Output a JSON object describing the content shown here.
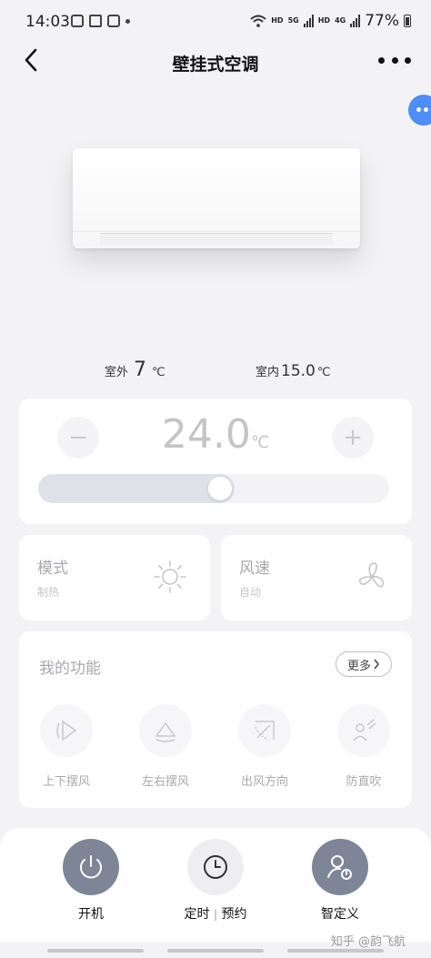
{
  "status_bar": {
    "time": "14:03",
    "hd1": "HD",
    "net1": "5G",
    "hd2": "HD",
    "net2": "4G",
    "battery": "77%"
  },
  "header": {
    "title": "壁挂式空调"
  },
  "temps": {
    "outdoor_label": "室外",
    "outdoor_value": "7",
    "outdoor_unit": "℃",
    "indoor_label": "室内",
    "indoor_value": "15.0",
    "indoor_unit": "℃"
  },
  "setpoint": {
    "minus": "−",
    "plus": "+",
    "value": "24.0",
    "unit": "℃",
    "slider_fraction": 0.56
  },
  "mode_card": {
    "title": "模式",
    "value": "制热",
    "icon": "sun-icon"
  },
  "speed_card": {
    "title": "风速",
    "value": "自动",
    "icon": "fan-icon"
  },
  "functions": {
    "title": "我的功能",
    "more_label": "更多",
    "items": [
      {
        "label": "上下摆风",
        "icon": "vertical-swing-icon"
      },
      {
        "label": "左右摆风",
        "icon": "horizontal-swing-icon"
      },
      {
        "label": "出风方向",
        "icon": "wind-direction-icon"
      },
      {
        "label": "防直吹",
        "icon": "anti-direct-blow-icon"
      }
    ]
  },
  "bottom_bar": {
    "power_label": "开机",
    "timer_label": "定时",
    "timer_sep": "|",
    "schedule_label": "预约",
    "smart_label": "智定义"
  },
  "watermark": "知乎 @韵飞航",
  "colors": {
    "accent_bubble": "#4e8cf6",
    "dark_button": "#7d8597",
    "disabled_text": "#a9a9ad"
  }
}
